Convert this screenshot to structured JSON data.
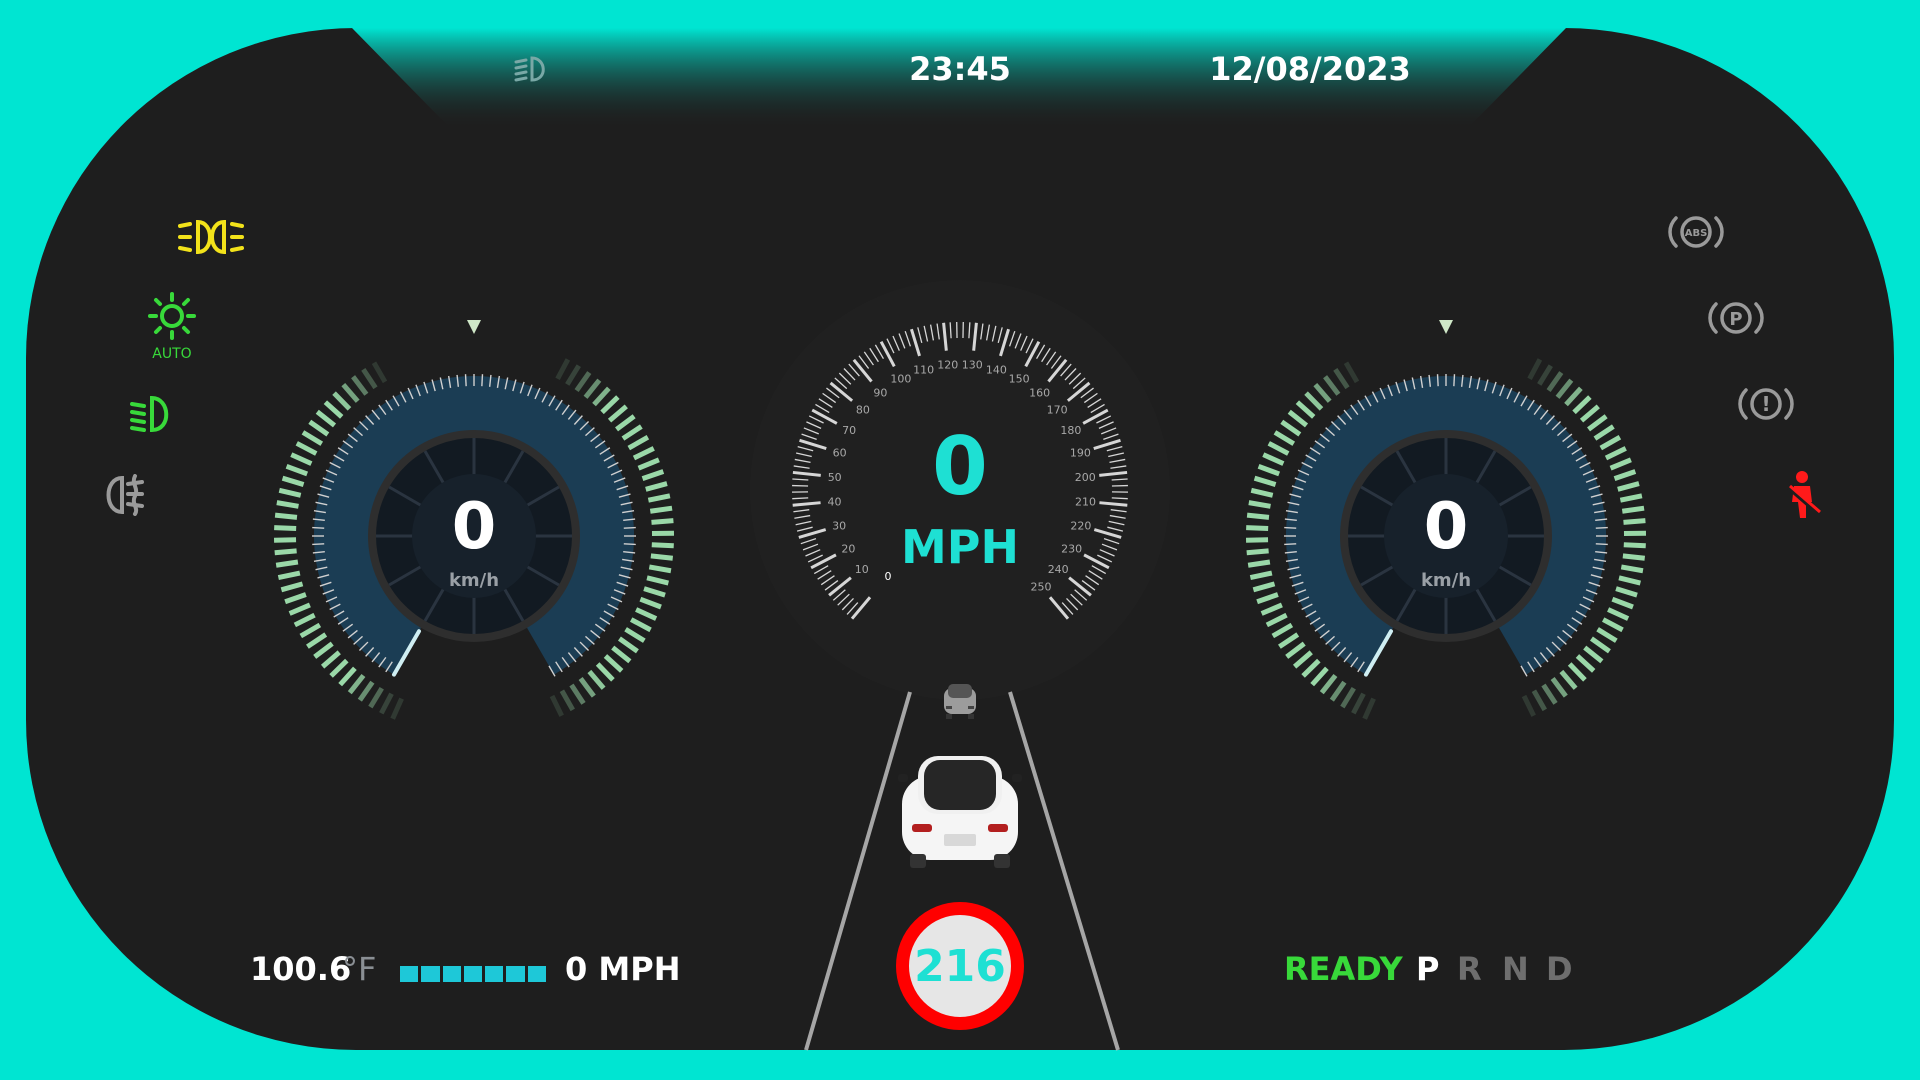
{
  "header": {
    "time": "23:45",
    "date": "12/08/2023"
  },
  "indicators_left": [
    {
      "name": "high-beam-icon",
      "color": "#f2e21a",
      "active": true
    },
    {
      "name": "auto-light-icon",
      "color": "#38d93a",
      "active": true,
      "label": "AUTO"
    },
    {
      "name": "low-beam-icon",
      "color": "#38d93a",
      "active": true
    },
    {
      "name": "fog-light-icon",
      "color": "#8a8a8a",
      "active": false
    }
  ],
  "indicators_right": [
    {
      "name": "abs-warning-icon",
      "color": "#8a8a8a",
      "active": false,
      "label": "ABS"
    },
    {
      "name": "parking-brake-icon",
      "color": "#8a8a8a",
      "active": false,
      "label": "P"
    },
    {
      "name": "brake-warning-icon",
      "color": "#8a8a8a",
      "active": false,
      "label": "!"
    },
    {
      "name": "seatbelt-warning-icon",
      "color": "#ff1a1a",
      "active": true
    }
  ],
  "left_gauge": {
    "value": "0",
    "unit": "km/h"
  },
  "right_gauge": {
    "value": "0",
    "unit": "km/h"
  },
  "speedometer": {
    "value": "0",
    "unit": "MPH",
    "scale": [
      "0",
      "10",
      "20",
      "30",
      "40",
      "50",
      "60",
      "70",
      "80",
      "90",
      "100",
      "110",
      "120",
      "130",
      "140",
      "150",
      "160",
      "170",
      "180",
      "190",
      "200",
      "210",
      "220",
      "230",
      "240",
      "250"
    ]
  },
  "speed_limit": "216",
  "bottom_left": {
    "temperature": "100.6",
    "temperature_unit": "°F",
    "range_level": 1.0,
    "speed": "0 MPH"
  },
  "bottom_right": {
    "status": "READY",
    "gears": [
      "P",
      "R",
      "N",
      "D"
    ],
    "selected_gear": "P"
  },
  "colors": {
    "accent": "#00e5d2",
    "background": "#1e1e1e",
    "gauge_fill": "#1b3d54",
    "tick_green": "#9ad8a8",
    "ready_green": "#38d93a"
  }
}
